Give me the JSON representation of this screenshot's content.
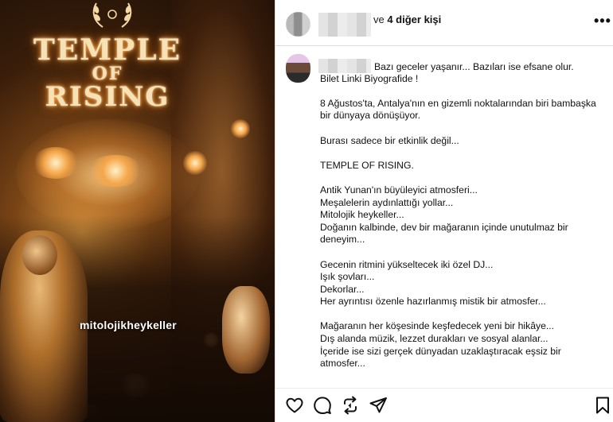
{
  "image": {
    "title_line1": "TEMPLE",
    "title_line2": "OF",
    "title_line3": "RISING",
    "watermark_prefix": "mitolojik",
    "watermark_suffix": "heykeller"
  },
  "header": {
    "collab_suffix": "ve ",
    "collab_count": "4 diğer kişi",
    "more_label": "•••"
  },
  "caption": {
    "first_line": "Bazı geceler yaşanır... Bazıları ise efsane olur.",
    "lines": [
      "",
      "Bilet Linki Biyografide !",
      "",
      "8 Ağustos'ta, Antalya'nın en gizemli noktalarından biri bambaşka",
      "bir dünyaya dönüşüyor.",
      "",
      "Burası sadece bir etkinlik değil...",
      "",
      "TEMPLE OF RISING.",
      "",
      "Antik Yunan'ın büyüleyici atmosferi...",
      "Meşalelerin aydınlattığı yollar...",
      "Mitolojik heykeller...",
      "Doğanın kalbinde, dev bir mağaranın içinde unutulmaz bir",
      "deneyim...",
      "",
      "Gecenin ritmini yükseltecek iki özel DJ...",
      "Işık şovları...",
      "Dekorlar...",
      "Her ayrıntısı özenle hazırlanmış mistik bir atmosfer...",
      "",
      "Mağaranın her köşesinde keşfedecek yeni bir hikâye...",
      "Dış alanda müzik, lezzet durakları ve sosyal alanlar...",
      "İçeride ise sizi gerçek dünyadan uzaklaştıracak eşsiz bir",
      "atmosfer..."
    ]
  },
  "actions": {
    "icons": [
      "heart-icon",
      "comment-icon",
      "repost-icon",
      "share-icon",
      "bookmark-icon"
    ]
  }
}
